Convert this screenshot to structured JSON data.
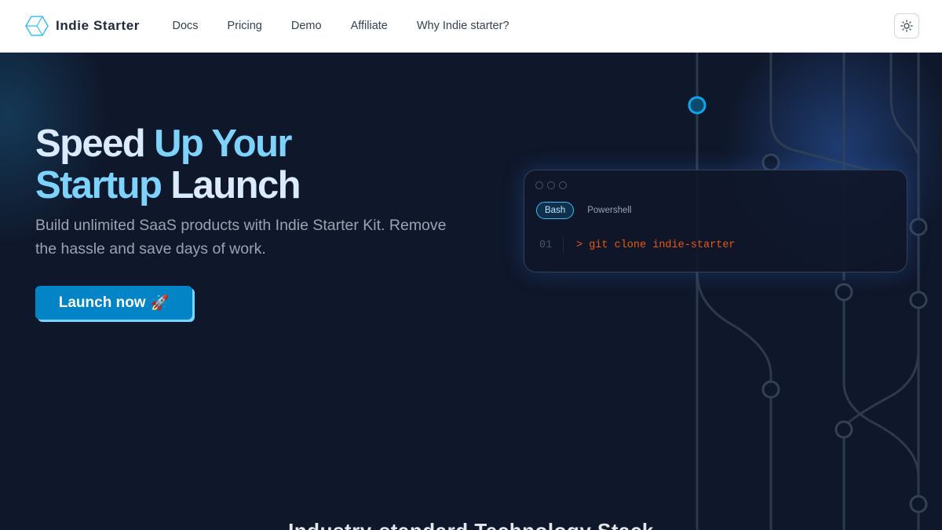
{
  "header": {
    "brand": "Indie Starter",
    "nav": [
      {
        "label": "Docs"
      },
      {
        "label": "Pricing"
      },
      {
        "label": "Demo"
      },
      {
        "label": "Affiliate"
      },
      {
        "label": "Why Indie starter?"
      }
    ],
    "theme_toggle_icon": "sun-icon"
  },
  "hero": {
    "headline_line1_a": "Speed",
    "headline_line1_b": "Up Your",
    "headline_line2_a": "Startup",
    "headline_line2_b": "Launch",
    "subtext": "Build unlimited SaaS products with Indie Starter Kit. Remove the hassle and save days of work.",
    "cta_label": "Launch now",
    "cta_emoji": "🚀"
  },
  "terminal": {
    "tabs": [
      {
        "label": "Bash",
        "active": true
      },
      {
        "label": "Powershell",
        "active": false
      }
    ],
    "line_number": "01",
    "command": "> git clone indie-starter"
  },
  "next_section": {
    "heading": "Industry-standard Technology Stack"
  },
  "colors": {
    "background": "#0f172a",
    "accent": "#0284c7",
    "accent_shadow": "#7dd3fc",
    "command": "#ea580c"
  }
}
